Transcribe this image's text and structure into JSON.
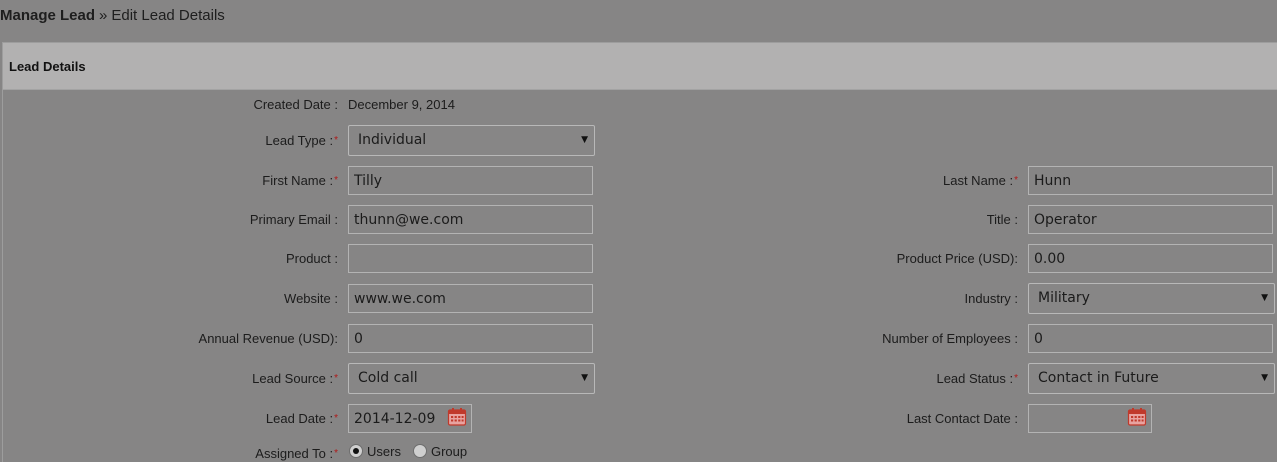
{
  "breadcrumb": {
    "parent": "Manage Lead",
    "separator": "»",
    "current": "Edit Lead Details"
  },
  "panel": {
    "title": "Lead Details"
  },
  "form": {
    "created_date": {
      "label": "Created Date :",
      "value": "December 9, 2014"
    },
    "lead_type": {
      "label": "Lead Type :",
      "value": "Individual"
    },
    "first_name": {
      "label": "First Name :",
      "value": "Tilly"
    },
    "last_name": {
      "label": "Last Name :",
      "value": "Hunn"
    },
    "primary_email": {
      "label": "Primary Email :",
      "value": "thunn@we.com"
    },
    "title": {
      "label": "Title :",
      "value": "Operator"
    },
    "product": {
      "label": "Product :",
      "value": ""
    },
    "product_price": {
      "label": "Product Price (USD):",
      "value": "0.00"
    },
    "website": {
      "label": "Website :",
      "value": "www.we.com"
    },
    "industry": {
      "label": "Industry :",
      "value": "Military"
    },
    "annual_revenue": {
      "label": "Annual Revenue (USD):",
      "value": "0"
    },
    "number_of_employees": {
      "label": "Number of Employees :",
      "value": "0"
    },
    "lead_source": {
      "label": "Lead Source :",
      "value": "Cold call"
    },
    "lead_status": {
      "label": "Lead Status :",
      "value": "Contact in Future"
    },
    "lead_date": {
      "label": "Lead Date :",
      "value": "2014-12-09"
    },
    "last_contact_date": {
      "label": "Last Contact Date :",
      "value": ""
    },
    "assigned_to": {
      "label": "Assigned To :",
      "options": [
        "Users",
        "Group"
      ],
      "selected": "Users"
    }
  },
  "icons": {
    "calendar": "calendar-icon",
    "dropdown": "chevron-down-icon"
  },
  "colors": {
    "required_marker": "#b01818",
    "calendar_icon": "#c0392b"
  }
}
